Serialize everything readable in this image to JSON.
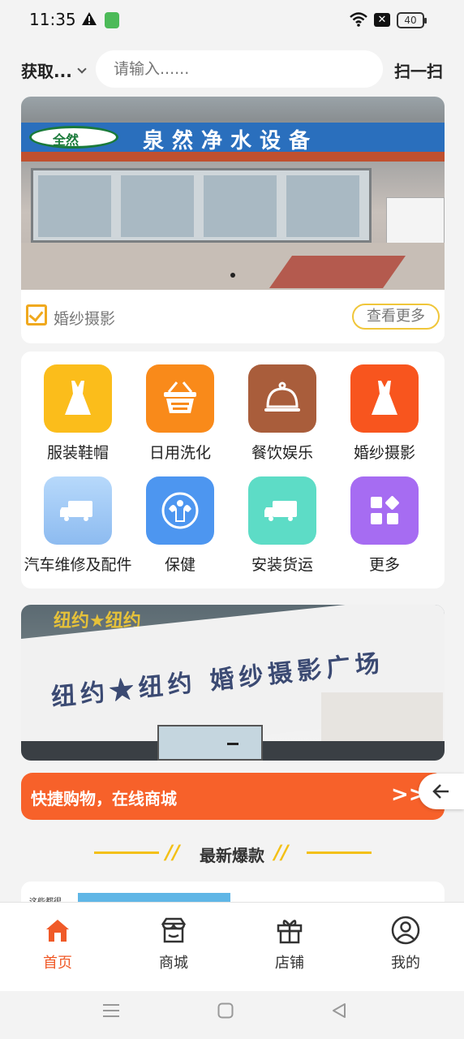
{
  "status": {
    "time": "11:35",
    "battery": "40"
  },
  "header": {
    "location_label": "获取...",
    "search_placeholder": "请输入......",
    "scan_label": "扫一扫"
  },
  "banner": {
    "sign_logo_text": "全然",
    "sign_text": "泉然净水设备",
    "category_label": "婚纱摄影",
    "more_label": "查看更多"
  },
  "categories": [
    {
      "label": "服装鞋帽",
      "icon": "dress-icon",
      "color": "#fbbd1b"
    },
    {
      "label": "日用洗化",
      "icon": "basket-icon",
      "color": "#f98a1a"
    },
    {
      "label": "餐饮娱乐",
      "icon": "cloche-icon",
      "color": "#a95d3b"
    },
    {
      "label": "婚纱摄影",
      "icon": "dress-icon",
      "color": "#f8551e"
    },
    {
      "label": "汽车维修及配件",
      "icon": "truck-icon",
      "color": "#9cc7f5"
    },
    {
      "label": "保健",
      "icon": "fitness-icon",
      "color": "#4d96f0"
    },
    {
      "label": "安装货运",
      "icon": "truck-icon",
      "color": "#5ddcc6"
    },
    {
      "label": "更多",
      "icon": "grid-icon",
      "color": "#a66cf2"
    }
  ],
  "banner2": {
    "top_sign": "纽约★纽约",
    "sign_text": "纽约★纽约 婚纱摄影广场"
  },
  "promo": {
    "text": "快捷购物，在线商城",
    "arrow": ">>"
  },
  "section": {
    "title": "最新爆款"
  },
  "product_peek": {
    "text": "这些都很"
  },
  "tabs": [
    {
      "label": "首页",
      "icon": "home-icon",
      "active": true
    },
    {
      "label": "商城",
      "icon": "store-icon",
      "active": false
    },
    {
      "label": "店铺",
      "icon": "gift-icon",
      "active": false
    },
    {
      "label": "我的",
      "icon": "user-icon",
      "active": false
    }
  ],
  "colors": {
    "accent": "#f05a28",
    "promo": "#f7612a",
    "highlight": "#f3c016"
  }
}
